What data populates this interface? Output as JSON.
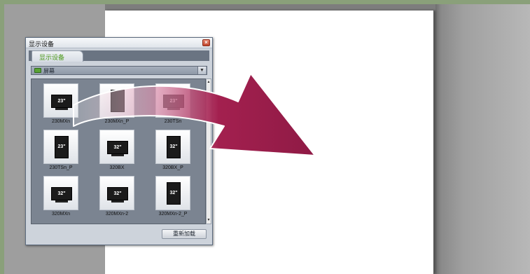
{
  "dialog": {
    "title": "显示设备",
    "tab_label": "显示设备",
    "dropdown": {
      "selected": "屏幕"
    },
    "reload_label": "重新加载",
    "devices": [
      {
        "label": "230MXn",
        "screen_text": "23\"",
        "orientation": "landscape"
      },
      {
        "label": "230MXn_P",
        "screen_text": "",
        "orientation": "portrait"
      },
      {
        "label": "230TSn",
        "screen_text": "23\"",
        "orientation": "landscape"
      },
      {
        "label": "230TSn_P",
        "screen_text": "23\"",
        "orientation": "portrait"
      },
      {
        "label": "320BX",
        "screen_text": "32\"",
        "orientation": "landscape"
      },
      {
        "label": "320BX_P",
        "screen_text": "32\"",
        "orientation": "portrait"
      },
      {
        "label": "320MXn",
        "screen_text": "32\"",
        "orientation": "landscape"
      },
      {
        "label": "320MXn-2",
        "screen_text": "32\"",
        "orientation": "landscape"
      },
      {
        "label": "320MXn-2_P",
        "screen_text": "32\"",
        "orientation": "portrait"
      }
    ]
  },
  "colors": {
    "arrow": "#a3204f",
    "dialog_bg": "#cdd3db",
    "grid_bg": "#7b8491",
    "tab_text": "#4d9a1c"
  },
  "icons": {
    "close": "close-icon",
    "folder": "folder-icon",
    "dropdown": "chevron-down-icon",
    "drag_arrow": "drag-arrow-icon"
  }
}
